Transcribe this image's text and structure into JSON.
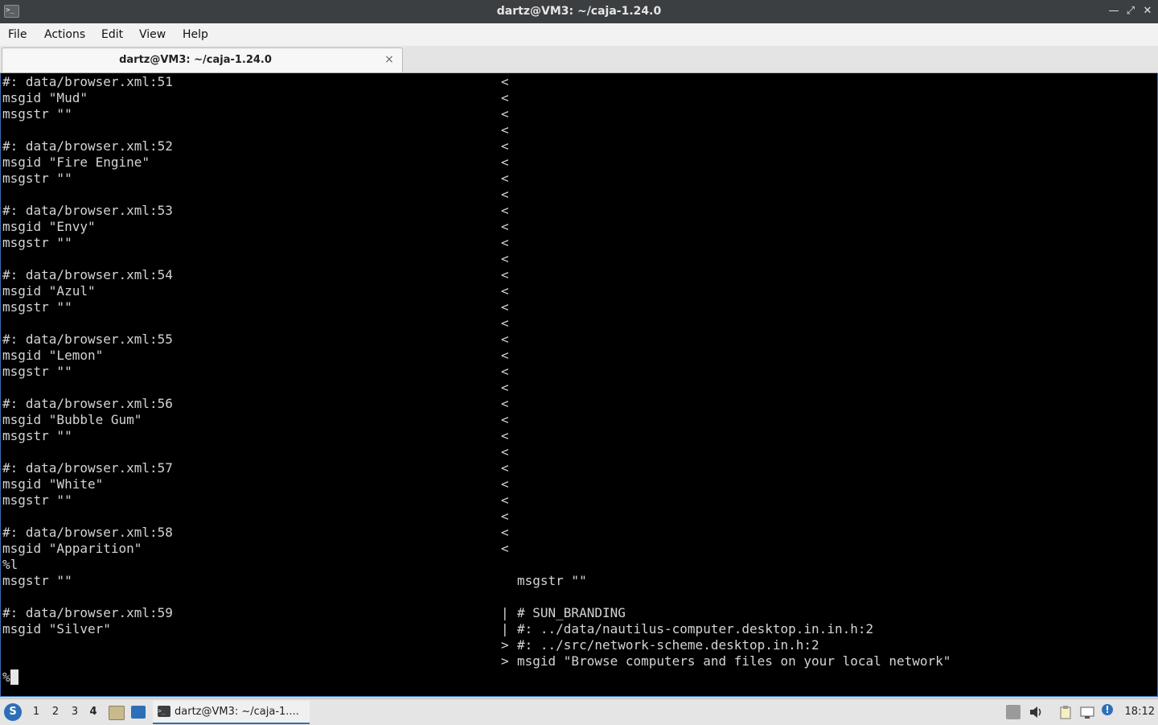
{
  "window": {
    "title": "dartz@VM3: ~/caja-1.24.0",
    "app_icon": "terminal-icon"
  },
  "menu": [
    "File",
    "Actions",
    "Edit",
    "View",
    "Help"
  ],
  "tab": {
    "label": "dartz@VM3: ~/caja-1.24.0",
    "close": "×"
  },
  "terminal": {
    "lines": [
      {
        "left": "#: data/browser.xml:51",
        "mid": "<",
        "right": ""
      },
      {
        "left": "msgid \"Mud\"",
        "mid": "<",
        "right": ""
      },
      {
        "left": "msgstr \"\"",
        "mid": "<",
        "right": ""
      },
      {
        "left": "",
        "mid": "<",
        "right": ""
      },
      {
        "left": "#: data/browser.xml:52",
        "mid": "<",
        "right": ""
      },
      {
        "left": "msgid \"Fire Engine\"",
        "mid": "<",
        "right": ""
      },
      {
        "left": "msgstr \"\"",
        "mid": "<",
        "right": ""
      },
      {
        "left": "",
        "mid": "<",
        "right": ""
      },
      {
        "left": "#: data/browser.xml:53",
        "mid": "<",
        "right": ""
      },
      {
        "left": "msgid \"Envy\"",
        "mid": "<",
        "right": ""
      },
      {
        "left": "msgstr \"\"",
        "mid": "<",
        "right": ""
      },
      {
        "left": "",
        "mid": "<",
        "right": ""
      },
      {
        "left": "#: data/browser.xml:54",
        "mid": "<",
        "right": ""
      },
      {
        "left": "msgid \"Azul\"",
        "mid": "<",
        "right": ""
      },
      {
        "left": "msgstr \"\"",
        "mid": "<",
        "right": ""
      },
      {
        "left": "",
        "mid": "<",
        "right": ""
      },
      {
        "left": "#: data/browser.xml:55",
        "mid": "<",
        "right": ""
      },
      {
        "left": "msgid \"Lemon\"",
        "mid": "<",
        "right": ""
      },
      {
        "left": "msgstr \"\"",
        "mid": "<",
        "right": ""
      },
      {
        "left": "",
        "mid": "<",
        "right": ""
      },
      {
        "left": "#: data/browser.xml:56",
        "mid": "<",
        "right": ""
      },
      {
        "left": "msgid \"Bubble Gum\"",
        "mid": "<",
        "right": ""
      },
      {
        "left": "msgstr \"\"",
        "mid": "<",
        "right": ""
      },
      {
        "left": "",
        "mid": "<",
        "right": ""
      },
      {
        "left": "#: data/browser.xml:57",
        "mid": "<",
        "right": ""
      },
      {
        "left": "msgid \"White\"",
        "mid": "<",
        "right": ""
      },
      {
        "left": "msgstr \"\"",
        "mid": "<",
        "right": ""
      },
      {
        "left": "",
        "mid": "<",
        "right": ""
      },
      {
        "left": "#: data/browser.xml:58",
        "mid": "<",
        "right": ""
      },
      {
        "left": "msgid \"Apparition\"",
        "mid": "<",
        "right": ""
      },
      {
        "left": "%l",
        "mid": "",
        "right": ""
      },
      {
        "left": "msgstr \"\"",
        "mid": "",
        "right": "msgstr \"\""
      },
      {
        "left": "",
        "mid": "",
        "right": ""
      },
      {
        "left": "#: data/browser.xml:59",
        "mid": "|",
        "right": "# SUN_BRANDING"
      },
      {
        "left": "msgid \"Silver\"",
        "mid": "|",
        "right": "#: ../data/nautilus-computer.desktop.in.in.h:2"
      },
      {
        "left": "",
        "mid": ">",
        "right": "#: ../src/network-scheme.desktop.in.h:2"
      },
      {
        "left": "",
        "mid": ">",
        "right": "msgid \"Browse computers and files on your local network\""
      }
    ],
    "prompt": "%"
  },
  "taskbar": {
    "menu_icon": "start-menu-icon",
    "workspaces": [
      "1",
      "2",
      "3",
      "4"
    ],
    "active_workspace": "4",
    "task_label": "dartz@VM3: ~/caja-1....",
    "clock": "18:12"
  }
}
